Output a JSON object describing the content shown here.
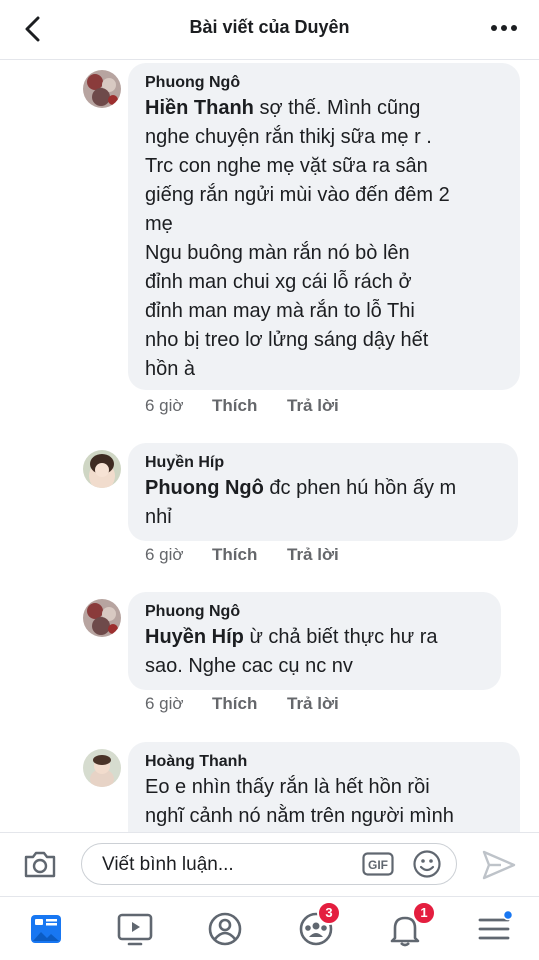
{
  "header": {
    "title": "Bài viết của Duyên"
  },
  "comments": [
    {
      "author": "Phuong Ngô",
      "mention": "Hiền Thanh",
      "text": " sợ thế.  Mình cũng\nnghe chuyện rắn thikj sữa mẹ r .\nTrc  con  nghe  mẹ vặt sữa ra sân\ngiếng rắn ngửi mùi vào đến đêm  2\nmẹ\nNgu  buông màn rắn nó bò lên\nđỉnh man chui  xg  cái lỗ rách ở\nđỉnh man may mà rắn to lỗ  Thi\nnho  bị treo lơ lửng sáng dậy hết\nhồn à",
      "time": "6 giờ",
      "like": "Thích",
      "reply": "Trả lời"
    },
    {
      "author": "Huyền Híp",
      "mention": "Phuong Ngô",
      "text": " đc phen hú hồn ấy m\nnhỉ",
      "time": "6 giờ",
      "like": "Thích",
      "reply": "Trả lời"
    },
    {
      "author": "Phuong Ngô",
      "mention": "Huyền Híp",
      "text": " ừ  chả biết thực hư ra\nsao. Nghe  cac  cụ nc  nv",
      "time": "6 giờ",
      "like": "Thích",
      "reply": "Trả lời"
    },
    {
      "author": "Hoàng Thanh",
      "mention": "",
      "text": "Eo e nhìn thấy rắn là hết hồn rồi\nnghĩ cảnh nó nằm trên người mình"
    }
  ],
  "composer": {
    "placeholder": "Viết bình luận...",
    "gif_label": "GIF"
  },
  "tabbar": {
    "groups_badge": "3",
    "notifications_badge": "1"
  },
  "colors": {
    "accent": "#1877f2",
    "badge": "#e41e3f",
    "bubble": "#f0f2f5",
    "meta": "#65676b"
  }
}
